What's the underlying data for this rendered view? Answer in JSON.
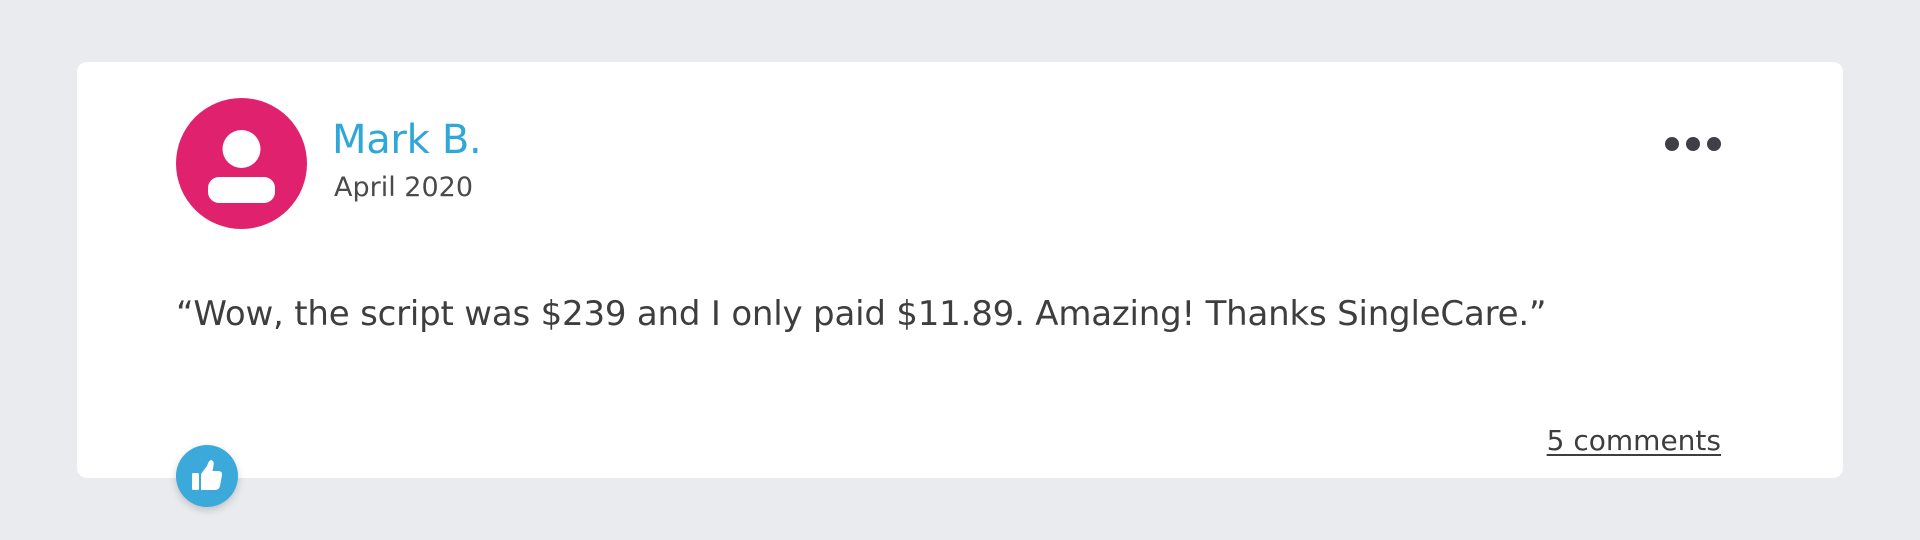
{
  "review": {
    "author": "Mark B.",
    "date": "April 2020",
    "text": "“Wow, the script was $239 and I only paid $11.89. Amazing! Thanks SingleCare.”",
    "comments_label": "5 comments"
  },
  "icons": {
    "avatar": "user-icon",
    "menu": "more-horizontal-icon",
    "like": "thumbs-up-icon"
  },
  "colors": {
    "background": "#e9ebef",
    "card": "#ffffff",
    "avatar": "#e0226e",
    "author_name": "#2fa7d8",
    "like_button": "#3ba9da",
    "text": "#3e3e3e"
  }
}
